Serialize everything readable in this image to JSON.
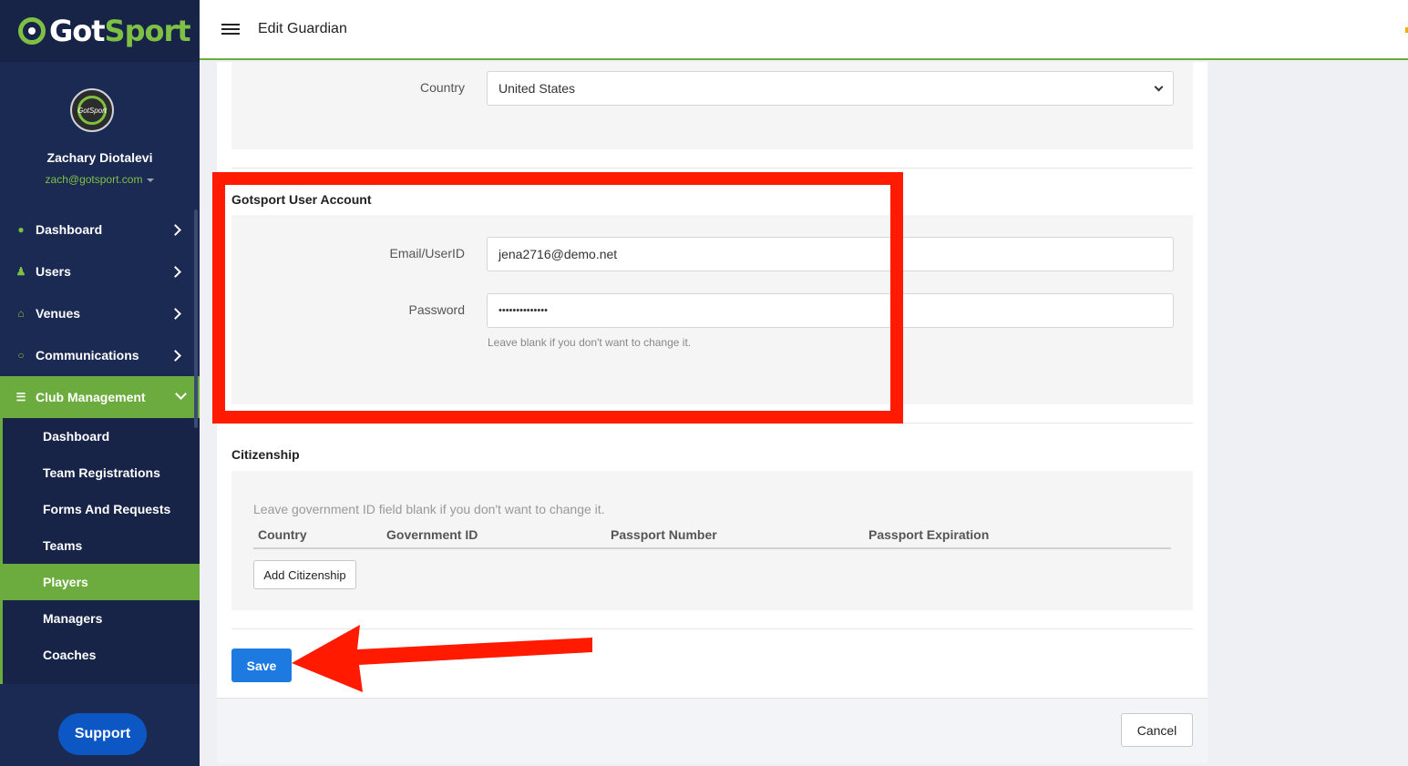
{
  "brand": {
    "got": "Got",
    "sport": "Sport",
    "avatar_text": "GotSport"
  },
  "user": {
    "name": "Zachary Diotalevi",
    "email": "zach@gotsport.com"
  },
  "nav": {
    "items": [
      {
        "label": "Dashboard",
        "icon": "palette-icon"
      },
      {
        "label": "Users",
        "icon": "users-icon"
      },
      {
        "label": "Venues",
        "icon": "home-icon"
      },
      {
        "label": "Communications",
        "icon": "chat-icon"
      },
      {
        "label": "Club Management",
        "icon": "list-icon"
      }
    ],
    "sub_items": [
      {
        "label": "Dashboard"
      },
      {
        "label": "Team Registrations"
      },
      {
        "label": "Forms And Requests"
      },
      {
        "label": "Teams"
      },
      {
        "label": "Players"
      },
      {
        "label": "Managers"
      },
      {
        "label": "Coaches"
      }
    ],
    "active_sub_item": "Players"
  },
  "support": {
    "label": "Support"
  },
  "header": {
    "title": "Edit Guardian"
  },
  "address": {
    "country_label": "Country",
    "country_value": "United States"
  },
  "account": {
    "title": "Gotsport User Account",
    "email_label": "Email/UserID",
    "email_value": "jena2716@demo.net",
    "password_label": "Password",
    "password_value": "••••••••••••••",
    "password_help": "Leave blank if you don't want to change it."
  },
  "citizenship": {
    "title": "Citizenship",
    "help": "Leave government ID field blank if you don't want to change it.",
    "columns": [
      "Country",
      "Government ID",
      "Passport Number",
      "Passport Expiration"
    ],
    "add_label": "Add Citizenship"
  },
  "actions": {
    "save_label": "Save",
    "cancel_label": "Cancel"
  },
  "colors": {
    "brand_green": "#6cac3f",
    "sidebar": "#1b2a52",
    "primary": "#1d7ae0",
    "annotation_red": "#ff1a00"
  }
}
